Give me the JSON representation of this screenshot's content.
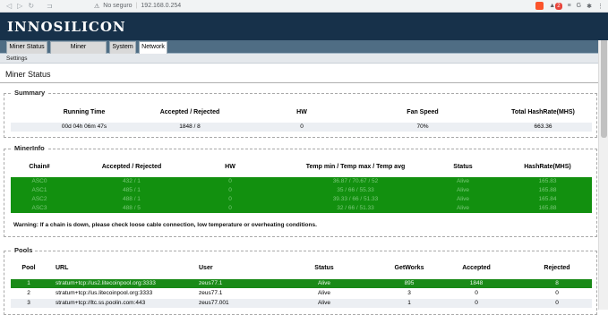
{
  "browser": {
    "security_label": "No seguro",
    "url": "192.168.0.254",
    "notif_count": "2"
  },
  "header": {
    "logo": "INNOSILICON"
  },
  "tabs": [
    {
      "label": "Miner Status"
    },
    {
      "label": "Miner Configuration"
    },
    {
      "label": "System"
    },
    {
      "label": "Network"
    }
  ],
  "subnav": {
    "settings": "Settings"
  },
  "page_title": "Miner Status",
  "summary": {
    "legend": "Summary",
    "headers": [
      "Running Time",
      "Accepted / Rejected",
      "HW",
      "Fan Speed",
      "Total HashRate(MHS)"
    ],
    "row": [
      "00d 04h 06m 47s",
      "1848 / 8",
      "0",
      "70%",
      "663.36"
    ]
  },
  "minerinfo": {
    "legend": "MinerInfo",
    "headers": [
      "Chain#",
      "Accepted / Rejected",
      "HW",
      "Temp min / Temp max / Temp avg",
      "Status",
      "HashRate(MHS)"
    ],
    "rows": [
      [
        "ASC0",
        "432 / 1",
        "0",
        "36.87 / 70.67 / 52",
        "Alive",
        "165.83"
      ],
      [
        "ASC1",
        "485 / 1",
        "0",
        "35 / 66 / 55.33",
        "Alive",
        "165.88"
      ],
      [
        "ASC2",
        "488 / 1",
        "0",
        "39.33 / 66 / 51.33",
        "Alive",
        "165.84"
      ],
      [
        "ASC3",
        "488 / 5",
        "0",
        "32 / 66 / 51.33",
        "Alive",
        "165.88"
      ]
    ],
    "warning": "Warning: If a chain is down, please check loose cable connection, low temperature or overheating conditions."
  },
  "pools": {
    "legend": "Pools",
    "headers": [
      "Pool",
      "URL",
      "User",
      "Status",
      "GetWorks",
      "Accepted",
      "Rejected"
    ],
    "rows": [
      [
        "1",
        "stratum+tcp://us2.litecoinpool.org:3333",
        "zeus77.1",
        "Alive",
        "895",
        "1848",
        "8"
      ],
      [
        "2",
        "stratum+tcp://us.litecoinpool.org:3333",
        "zeus77.1",
        "Alive",
        "3",
        "0",
        "0"
      ],
      [
        "3",
        "stratum+tcp://ltc.ss.poolin.com:443",
        "zeus77.001",
        "Alive",
        "1",
        "0",
        "0"
      ]
    ]
  }
}
